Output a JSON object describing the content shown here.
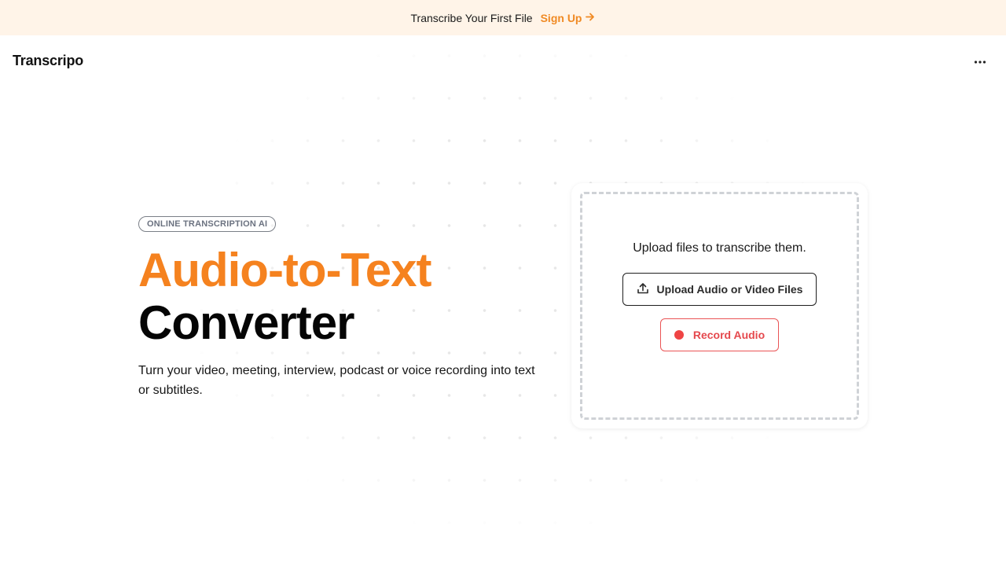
{
  "banner": {
    "text": "Transcribe Your First File",
    "link_label": "Sign Up",
    "link_icon": "arrow-right-icon"
  },
  "header": {
    "logo": "Transcripo",
    "menu_icon": "more-horizontal-icon"
  },
  "hero": {
    "tag": "ONLINE TRANSCRIPTION AI",
    "title_highlight": "Audio-to-Text",
    "title_rest": "Converter",
    "subtitle": "Turn your video, meeting, interview, podcast or voice recording into text or subtitles."
  },
  "upload": {
    "prompt": "Upload files to transcribe them.",
    "upload_button_label": "Upload Audio or Video Files",
    "upload_icon": "upload-icon",
    "record_button_label": "Record Audio",
    "record_icon": "record-dot-icon"
  },
  "colors": {
    "accent_orange": "#f5821f",
    "banner_background": "#fff4e8",
    "record_red": "#ef4444"
  }
}
